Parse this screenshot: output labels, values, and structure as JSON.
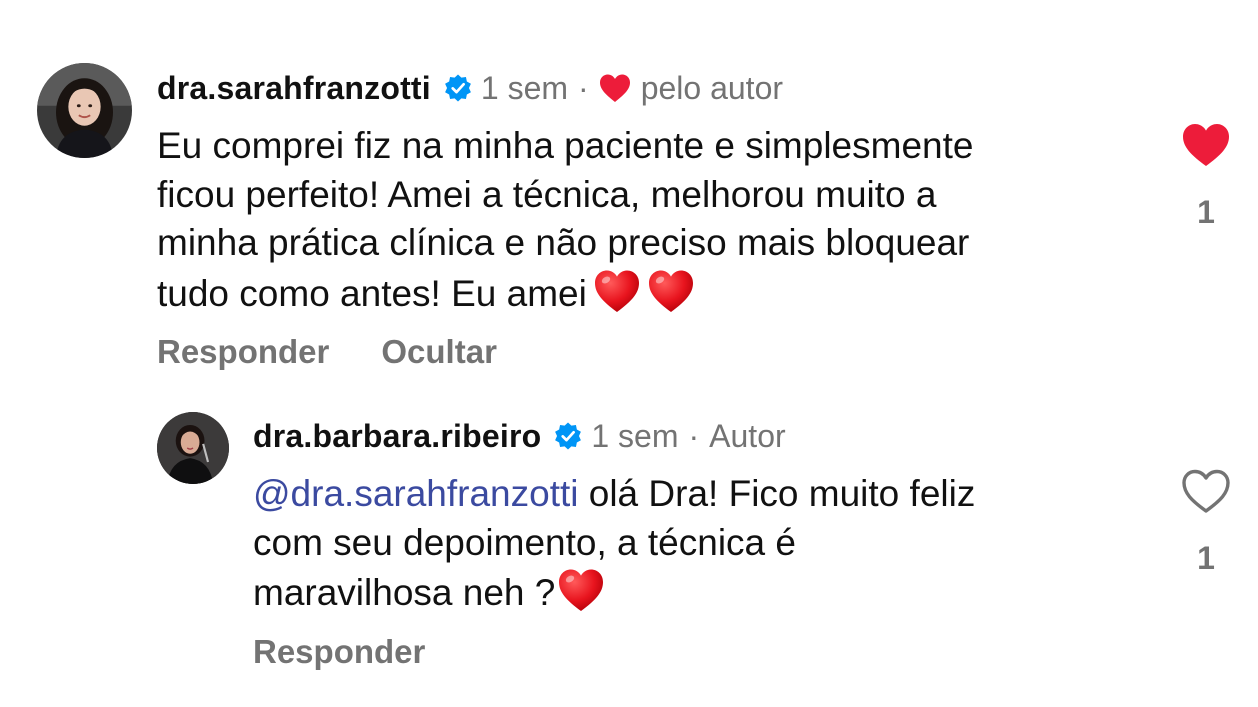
{
  "comment": {
    "username": "dra.sarahfranzotti",
    "time": "1 sem",
    "separator": "·",
    "liked_by_author_label": "pelo autor",
    "body_lines": [
      "Eu comprei fiz na minha paciente e simplesmente",
      "ficou perfeito! Amei a técnica, melhorou muito a",
      "minha prática clínica e não preciso mais bloquear",
      "tudo como antes! Eu amei"
    ],
    "actions": {
      "reply": "Responder",
      "hide": "Ocultar"
    },
    "like_count": "1",
    "liked": true
  },
  "reply": {
    "username": "dra.barbara.ribeiro",
    "time": "1 sem",
    "separator": "·",
    "role_label": "Autor",
    "mention": "@dra.sarahfranzotti",
    "body_line1_rest": " olá Dra! Fico muito feliz",
    "body_lines": [
      "com seu depoimento, a técnica é",
      "maravilhosa neh ?"
    ],
    "actions": {
      "reply": "Responder"
    },
    "like_count": "1",
    "liked": false
  },
  "colors": {
    "heart_red": "#ed1c3a",
    "verified_blue": "#0095f6",
    "muted_gray": "#737373",
    "mention_blue": "#3b4aa0"
  },
  "icons": {
    "verified": "verified-badge-icon",
    "heart": "heart-icon",
    "heart_outline": "heart-outline-icon"
  }
}
